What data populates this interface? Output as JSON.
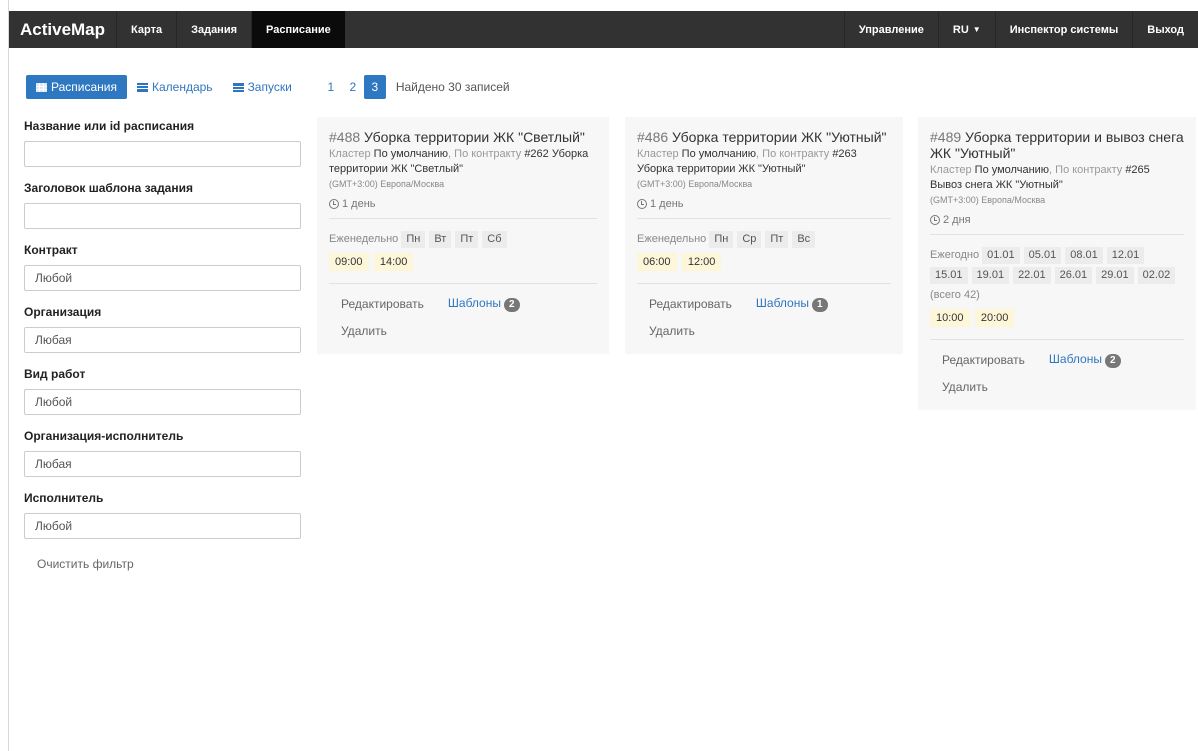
{
  "navbar": {
    "brand": "ActiveMap",
    "items": [
      "Карта",
      "Задания",
      "Расписание"
    ],
    "right_items": [
      "Управление",
      "RU",
      "Инспектор системы",
      "Выход"
    ]
  },
  "toolbar": {
    "schedules": "Расписания",
    "calendar": "Календарь",
    "runs": "Запуски",
    "pages": [
      "1",
      "2",
      "3"
    ],
    "active_page": "3",
    "found": "Найдено 30 записей"
  },
  "filter": {
    "name_label": "Название или id расписания",
    "name_value": "",
    "template_label": "Заголовок шаблона задания",
    "template_value": "",
    "contract_label": "Контракт",
    "contract_value": "Любой",
    "org_label": "Организация",
    "org_value": "Любая",
    "work_label": "Вид работ",
    "work_value": "Любой",
    "exec_org_label": "Организация-исполнитель",
    "exec_org_value": "Любая",
    "executor_label": "Исполнитель",
    "executor_value": "Любой",
    "clear": "Очистить фильтр"
  },
  "cards": [
    {
      "id": "#488",
      "title": "Уборка территории ЖК \"Светлый\"",
      "cluster_prefix": "Кластер",
      "cluster": "По умолчанию",
      "contract_prefix": ", По контракту",
      "contract": "#262 Уборка территории ЖК \"Светлый\"",
      "tz": "(GMT+3:00) Европа/Москва",
      "duration": "1 день",
      "rule": "Еженедельно",
      "tags": [
        "Пн",
        "Вт",
        "Пт",
        "Сб"
      ],
      "times": [
        "09:00",
        "14:00"
      ],
      "edit": "Редактировать",
      "templates": "Шаблоны",
      "templates_count": "2",
      "delete": "Удалить"
    },
    {
      "id": "#486",
      "title": "Уборка территории ЖК \"Уютный\"",
      "cluster_prefix": "Кластер",
      "cluster": "По умолчанию",
      "contract_prefix": ", По контракту",
      "contract": "#263 Уборка территории ЖК \"Уютный\"",
      "tz": "(GMT+3:00) Европа/Москва",
      "duration": "1 день",
      "rule": "Еженедельно",
      "tags": [
        "Пн",
        "Ср",
        "Пт",
        "Вс"
      ],
      "times": [
        "06:00",
        "12:00"
      ],
      "edit": "Редактировать",
      "templates": "Шаблоны",
      "templates_count": "1",
      "delete": "Удалить"
    },
    {
      "id": "#489",
      "title": "Уборка территории и вывоз снега ЖК \"Уютный\"",
      "cluster_prefix": "Кластер",
      "cluster": "По умолчанию",
      "contract_prefix": ", По контракту",
      "contract": "#265 Вывоз снега ЖК \"Уютный\"",
      "tz": "(GMT+3:00) Европа/Москва",
      "duration": "2 дня",
      "rule": "Ежегодно",
      "tags": [
        "01.01",
        "05.01",
        "08.01",
        "12.01",
        "15.01",
        "19.01",
        "22.01",
        "26.01",
        "29.01",
        "02.02"
      ],
      "tags_more": "(всего 42)",
      "times": [
        "10:00",
        "20:00"
      ],
      "edit": "Редактировать",
      "templates": "Шаблоны",
      "templates_count": "2",
      "delete": "Удалить"
    }
  ]
}
